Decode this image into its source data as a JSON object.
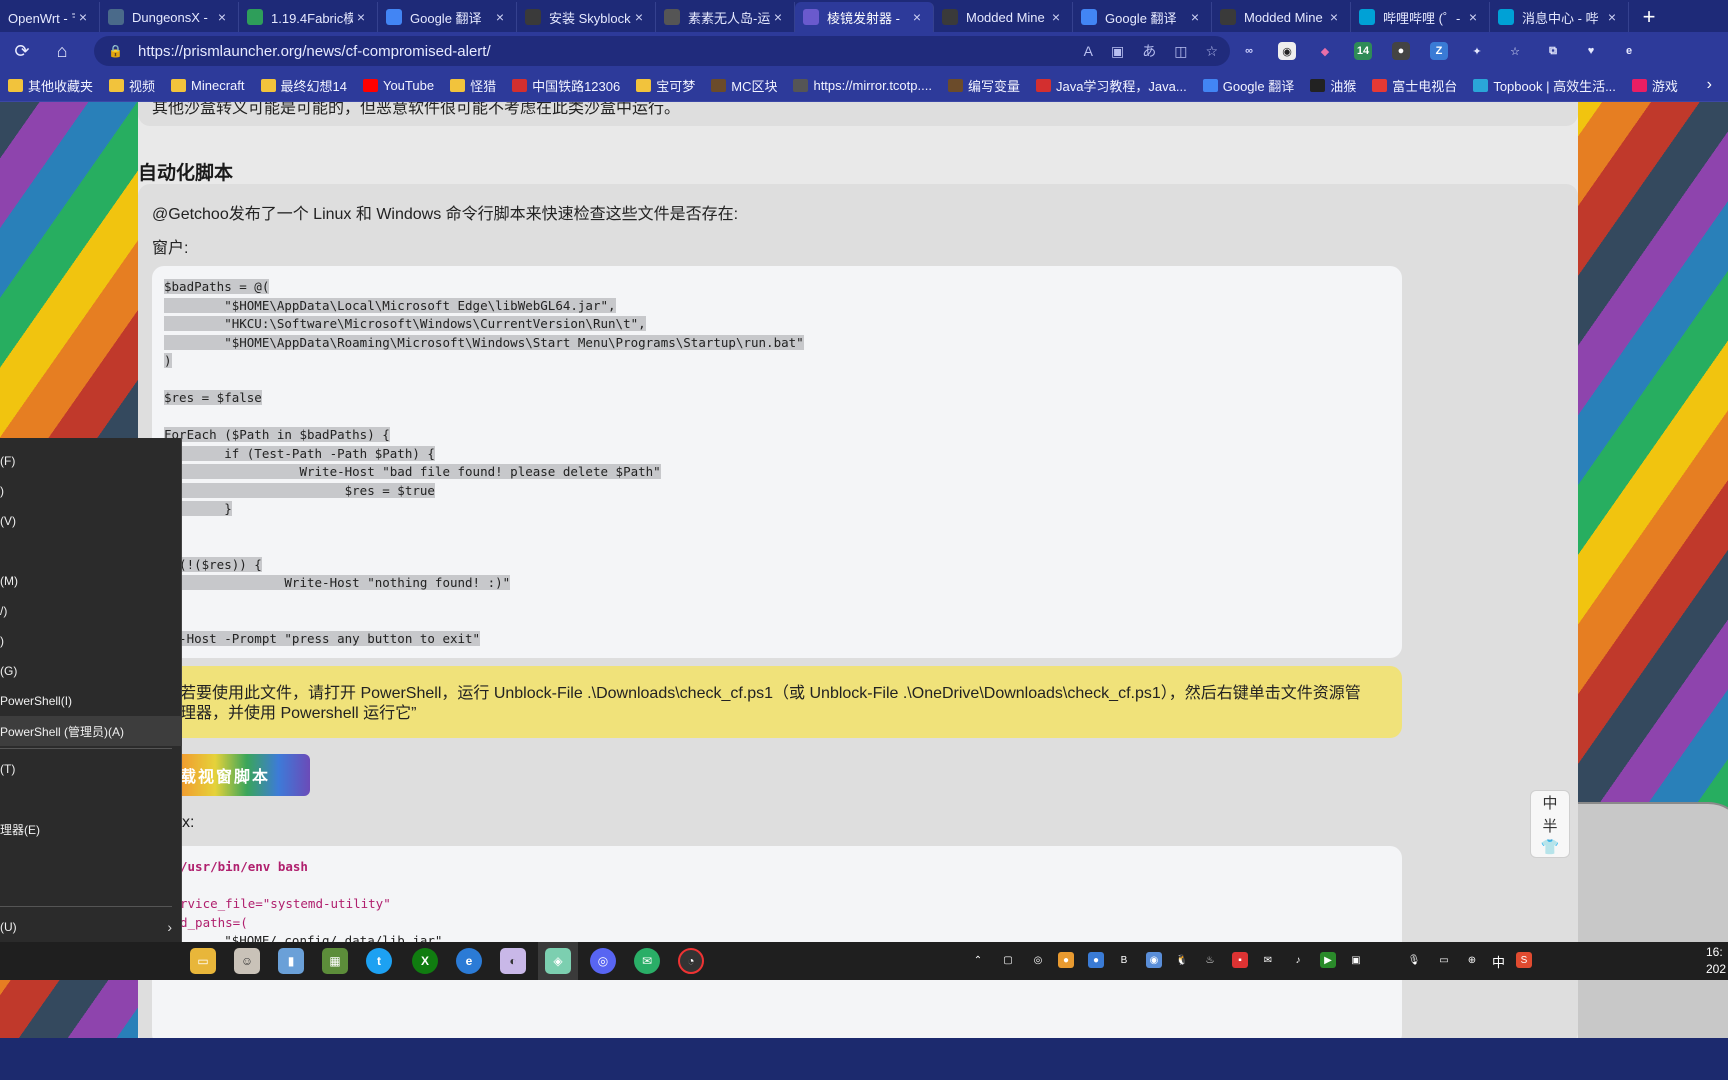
{
  "tabs": [
    {
      "label": "OpenWrt - 节",
      "icon": "openwrt-icon",
      "color": "#2a2a2a"
    },
    {
      "label": "DungeonsX -",
      "icon": "mc-icon",
      "color": "#4a6a8a"
    },
    {
      "label": "1.19.4Fabric模",
      "icon": "mcmod-icon",
      "color": "#2e9e5a"
    },
    {
      "label": "Google 翻译",
      "icon": "google-translate-icon",
      "color": "#4285f4"
    },
    {
      "label": "安装 Skyblock",
      "icon": "doc-icon",
      "color": "#3a3a3a"
    },
    {
      "label": "素素无人岛-运",
      "icon": "circle-logo-icon",
      "color": "#555555"
    },
    {
      "label": "棱镜发射器 -",
      "icon": "prism-icon",
      "color": "#6a5acd"
    },
    {
      "label": "Modded Mine",
      "icon": "doc-icon",
      "color": "#3a3a3a"
    },
    {
      "label": "Google 翻译",
      "icon": "google-translate-icon",
      "color": "#4285f4"
    },
    {
      "label": "Modded Mine",
      "icon": "doc-icon",
      "color": "#3a3a3a"
    },
    {
      "label": "哔哩哔哩 (゜-",
      "icon": "bilibili-icon",
      "color": "#00a1d6"
    },
    {
      "label": "消息中心 - 哔",
      "icon": "bilibili-icon",
      "color": "#00a1d6"
    }
  ],
  "active_tab_index": 6,
  "url": "https://prismlauncher.org/news/cf-compromised-alert/",
  "bookmarks": [
    {
      "label": "其他收藏夹",
      "icon": "folder-icon"
    },
    {
      "label": "视频",
      "icon": "folder-icon"
    },
    {
      "label": "Minecraft",
      "icon": "folder-icon"
    },
    {
      "label": "最终幻想14",
      "icon": "folder-icon"
    },
    {
      "label": "YouTube",
      "icon": "youtube-icon"
    },
    {
      "label": "怪猎",
      "icon": "folder-icon"
    },
    {
      "label": "中国铁路12306",
      "icon": "railway-icon"
    },
    {
      "label": "宝可梦",
      "icon": "folder-icon"
    },
    {
      "label": "MC区块",
      "icon": "block-icon"
    },
    {
      "label": "https://mirror.tcotp....",
      "icon": "mirror-icon"
    },
    {
      "label": "编写变量",
      "icon": "block-icon"
    },
    {
      "label": "Java学习教程，Java...",
      "icon": "c-red-icon"
    },
    {
      "label": "Google 翻译",
      "icon": "google-translate-icon"
    },
    {
      "label": "油猴",
      "icon": "tampermonkey-icon"
    },
    {
      "label": "富士电视台",
      "icon": "fuji-icon"
    },
    {
      "label": "Topbook | 高效生活...",
      "icon": "topbook-icon"
    },
    {
      "label": "游戏",
      "icon": "game-icon"
    }
  ],
  "article": {
    "top_note": "其他沙盒转义可能是可能的，但恶意软件很可能不考虑在此类沙盒中运行。",
    "section_title": "自动化脚本",
    "intro": "@Getchoo发布了一个 Linux 和 Windows 命令行脚本来快速检查这些文件是否存在:",
    "windows_label": "窗户:",
    "windows_code": [
      "$badPaths = @(",
      "        \"$HOME\\AppData\\Local\\Microsoft Edge\\libWebGL64.jar\",",
      "        \"HKCU:\\Software\\Microsoft\\Windows\\CurrentVersion\\Run\\t\",",
      "        \"$HOME\\AppData\\Roaming\\Microsoft\\Windows\\Start Menu\\Programs\\Startup\\run.bat\"",
      ")",
      "",
      "$res = $false",
      "",
      "ForEach ($Path in $badPaths) {",
      "        if (Test-Path -Path $Path) {",
      "                  Write-Host \"bad file found! please delete $Path\"",
      "                        $res = $true",
      "        }",
      "",
      "",
      "  (!($res)) {",
      "                Write-Host \"nothing found! :)\"",
      "",
      "",
      "ad-Host -Prompt \"press any button to exit\""
    ],
    "warning": "若要使用此文件，请打开 PowerShell，运行 Unblock-File .\\Downloads\\check_cf.ps1（或 Unblock-File .\\OneDrive\\Downloads\\check_cf.ps1），然后右键单击文件资源管理器，并使用 Powershell 运行它”",
    "download_button": "下载视窗脚本",
    "linux_label": "x:",
    "linux_code": [
      "/usr/bin/env bash",
      "",
      "rvice_file=\"systemd-utility\"",
      "d_paths=(",
      "        \"$HOME/.config/.data/lib.jar\""
    ]
  },
  "context_menu": [
    {
      "label": "(F)"
    },
    {
      "label": ")"
    },
    {
      "label": "(V)"
    },
    {
      "label": ""
    },
    {
      "label": "(M)"
    },
    {
      "label": "/)"
    },
    {
      "label": ")"
    },
    {
      "label": "(G)"
    },
    {
      "label": "PowerShell(I)"
    },
    {
      "label": "PowerShell (管理员)(A)"
    },
    {
      "label": "(T)"
    },
    {
      "label": ""
    },
    {
      "label": "理器(E)"
    },
    {
      "label": "(U)"
    }
  ],
  "ime": {
    "line1": "中",
    "line2": "半",
    "line3": "👕"
  },
  "taskbar_tray": {
    "lang": "中",
    "clock_time": "16:",
    "clock_date": "202"
  },
  "colors": {
    "accent": "#2d3a9a",
    "warning": "#f0e27a",
    "code_bg": "#f4f5f7"
  }
}
